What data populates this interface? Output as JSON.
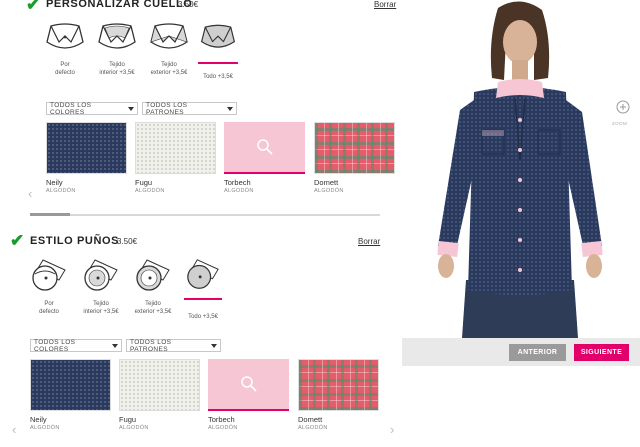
{
  "collar_section": {
    "title": "PERSONALIZAR CUELLO",
    "price": "3.50€",
    "reset": "Borrar",
    "options": [
      {
        "line1": "Por",
        "line2": "defecto"
      },
      {
        "line1": "Tejido",
        "line2": "interior +3,5€"
      },
      {
        "line1": "Tejido",
        "line2": "exterior +3,5€"
      },
      {
        "line1": "Todo +3,5€",
        "line2": ""
      }
    ],
    "selected_option": 3,
    "filters": {
      "colors": "TODOS LOS COLORES",
      "patterns": "TODOS LOS PATRONES"
    },
    "fabrics": [
      {
        "name": "Neily",
        "material": "ALGODÓN",
        "pattern": "navy-dots"
      },
      {
        "name": "Fugu",
        "material": "ALGODÓN",
        "pattern": "white-dots"
      },
      {
        "name": "Torbech",
        "material": "ALGODÓN",
        "pattern": "pink"
      },
      {
        "name": "Domett",
        "material": "ALGODÓN",
        "pattern": "plaid"
      }
    ],
    "selected_fabric": 2
  },
  "cuff_section": {
    "title": "ESTILO PUÑOS",
    "price": "3.50€",
    "reset": "Borrar",
    "options": [
      {
        "line1": "Por",
        "line2": "defecto"
      },
      {
        "line1": "Tejido",
        "line2": "interior +3,5€"
      },
      {
        "line1": "Tejido",
        "line2": "exterior +3,5€"
      },
      {
        "line1": "Todo +3,5€",
        "line2": ""
      }
    ],
    "selected_option": 3,
    "filters": {
      "colors": "TODOS LOS COLORES",
      "patterns": "TODOS LOS PATRONES"
    },
    "fabrics": [
      {
        "name": "Neily",
        "material": "ALGODÓN",
        "pattern": "navy-dots"
      },
      {
        "name": "Fugu",
        "material": "ALGODÓN",
        "pattern": "white-dots"
      },
      {
        "name": "Torbech",
        "material": "ALGODÓN",
        "pattern": "pink"
      },
      {
        "name": "Domett",
        "material": "ALGODÓN",
        "pattern": "plaid"
      }
    ],
    "selected_fabric": 2
  },
  "preview": {
    "zoom_label": "ZOOM",
    "prev_button": "ANTERIOR",
    "next_button": "SIGUIENTE"
  },
  "colors": {
    "accent": "#e2006a",
    "check": "#1a9b2e",
    "shirt": "#2a3a5f",
    "trim": "#f6c6d5"
  },
  "icons": {
    "check": "checkmark-icon",
    "zoom": "zoom-icon",
    "prev": "chevron-left-icon",
    "next": "chevron-right-icon"
  }
}
